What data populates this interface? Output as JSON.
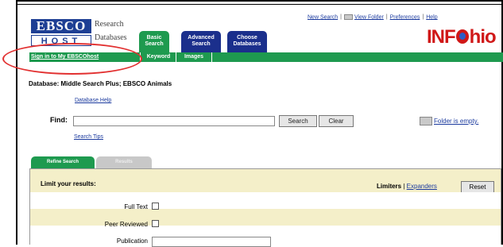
{
  "logo": {
    "brand": "EBSCO",
    "host": "HOST",
    "line1": "Research",
    "line2": "Databases"
  },
  "top_tabs": {
    "basic": "Basic Search",
    "advanced": "Advanced Search",
    "choose": "Choose Databases"
  },
  "top_links": {
    "new_search": "New Search",
    "view_folder": "View Folder",
    "preferences": "Preferences",
    "help": "Help"
  },
  "partner_logo": {
    "pre": "INF",
    "post": "hio"
  },
  "green_bar": {
    "sign_in": "Sign in to My EBSCOhost",
    "keyword": "Keyword",
    "images": "Images"
  },
  "database": {
    "text": "Database: Middle Search Plus; EBSCO Animals",
    "help": "Database Help"
  },
  "find": {
    "label": "Find:",
    "value": "",
    "search_btn": "Search",
    "clear_btn": "Clear",
    "tips": "Search Tips",
    "folder_status": "Folder is empty."
  },
  "refine_tabs": {
    "refine": "Refine Search",
    "results": "Results"
  },
  "limits": {
    "title": "Limit your results:",
    "limiters": "Limiters",
    "sep": "|",
    "expanders": "Expanders",
    "reset": "Reset",
    "full_text": "Full Text",
    "peer_reviewed": "Peer Reviewed",
    "publication": "Publication"
  },
  "colors": {
    "green": "#1e9a4f",
    "navy": "#1b2f8c",
    "beige": "#f4efc9",
    "annotation_red": "#e23030"
  }
}
